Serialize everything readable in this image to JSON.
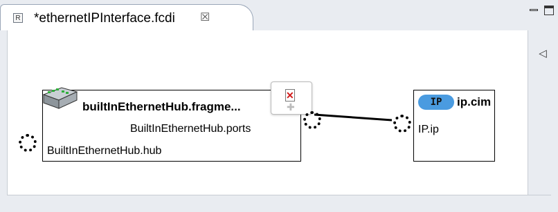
{
  "tab": {
    "title": "*ethernetIPInterface.fcdi",
    "icon": "resource-icon",
    "close": "☒"
  },
  "view": {
    "minimize": "minimize-icon",
    "maximize": "maximize-icon"
  },
  "palette": {
    "toggle": "◁"
  },
  "diagram": {
    "hub_node": {
      "title": "builtInEthernetHub.fragme...",
      "ports_label": "BuiltInEthernetHub.ports",
      "hub_label": "BuiltInEthernetHub.hub",
      "icon": "ethernet-hub-icon"
    },
    "ip_node": {
      "badge": "IP",
      "title": "ip.cim",
      "ip_label": "IP.ip"
    },
    "popup": {
      "delete_icon": "delete-icon",
      "add_icon": "plus-icon"
    }
  },
  "colors": {
    "badge": "#4a9be0",
    "delete": "#d21a1a",
    "border": "#000000"
  }
}
